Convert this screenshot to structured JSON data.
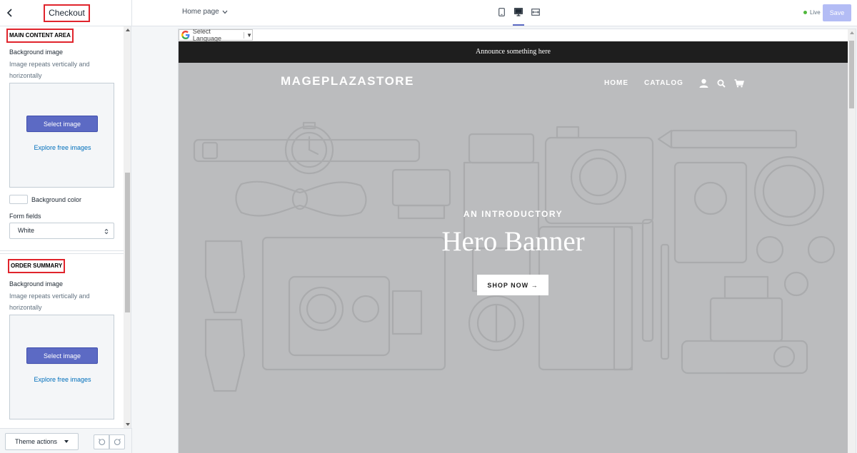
{
  "topbar": {
    "panel_title": "Checkout",
    "page_selector": "Home page",
    "live_label": "Live",
    "save_label": "Save"
  },
  "sidebar": {
    "main_content": {
      "heading": "MAIN CONTENT AREA",
      "bg_image_label": "Background image",
      "bg_image_help": "Image repeats vertically and horizontally",
      "select_image_label": "Select image",
      "explore_label": "Explore free images",
      "bg_color_label": "Background color",
      "form_fields_label": "Form fields",
      "form_fields_value": "White"
    },
    "order_summary": {
      "heading": "ORDER SUMMARY",
      "bg_image_label": "Background image",
      "bg_image_help": "Image repeats vertically and horizontally",
      "select_image_label": "Select image",
      "explore_label": "Explore free images"
    },
    "footer": {
      "theme_actions_label": "Theme actions"
    }
  },
  "preview": {
    "translate_label": "Select Language",
    "announcement": "Announce something here",
    "brand": "MAGEPLAZASTORE",
    "nav": [
      "HOME",
      "CATALOG"
    ],
    "hero_eyebrow": "AN INTRODUCTORY",
    "hero_title": "Hero Banner",
    "shop_button": "SHOP NOW →"
  },
  "colors": {
    "accent": "#5c6ac4",
    "highlight_border": "#e0242c",
    "link": "#006fbb",
    "live": "#50b83c",
    "hero_bg": "#bbbcbe",
    "announce_bg": "#1e1e1e"
  }
}
